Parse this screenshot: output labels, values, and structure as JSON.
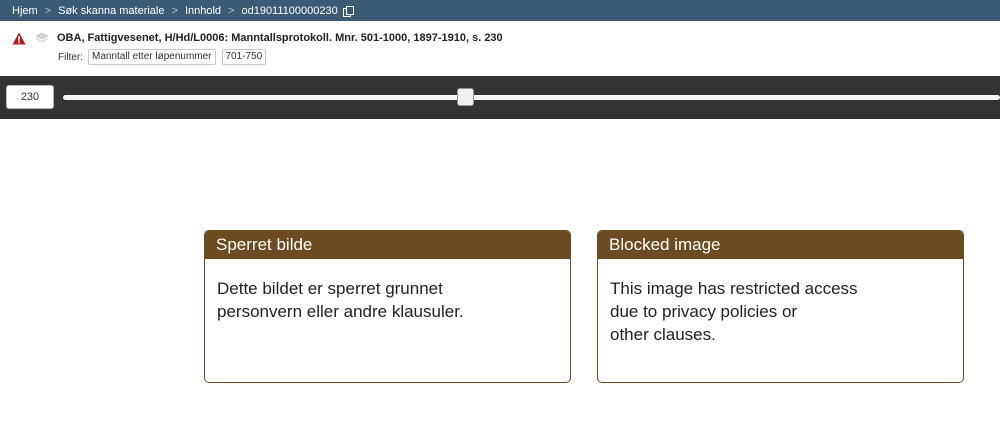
{
  "breadcrumb": {
    "items": [
      "Hjem",
      "Søk skanna materiale",
      "Innhold",
      "od19011100000230"
    ],
    "separator": ">"
  },
  "document": {
    "title": "OBA, Fattigvesenet, H/Hd/L0006: Manntallsprotokoll. Mnr. 501-1000, 1897-1910, s. 230"
  },
  "filter": {
    "label": "Filter:",
    "tags": [
      "Manntall etter løpenummer",
      "701-750"
    ]
  },
  "viewer": {
    "page_value": "230",
    "slider_position": 0.43
  },
  "notices": {
    "norwegian": {
      "heading": "Sperret bilde",
      "text": "Dette bildet er sperret grunnet\npersonvern eller andre klausuler."
    },
    "english": {
      "heading": "Blocked image",
      "text": "This image has restricted access\ndue to privacy policies or\nother clauses."
    }
  },
  "colors": {
    "breadcrumb_bg": "#3d5a74",
    "slider_bar_bg": "#333333",
    "panel_accent": "#6b4b1f",
    "warning_red": "#b31b1b"
  },
  "icons": {
    "warning": "warning-triangle-icon",
    "stack": "image-stack-icon",
    "copy": "copy-icon"
  }
}
